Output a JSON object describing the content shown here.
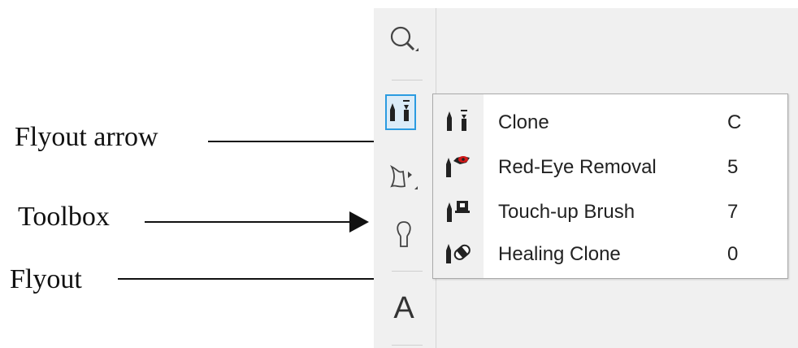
{
  "annotations": {
    "flyout_arrow": "Flyout arrow",
    "toolbox": "Toolbox",
    "flyout": "Flyout"
  },
  "toolbox": {
    "tools": [
      {
        "icon": "zoom-icon"
      },
      {
        "icon": "clone-tool-icon",
        "selected": true
      },
      {
        "icon": "smear-tool-icon"
      },
      {
        "icon": "paint-tool-icon"
      },
      {
        "icon": "text-tool-icon",
        "glyph": "A"
      }
    ]
  },
  "flyout_menu": {
    "items": [
      {
        "label": "Clone",
        "shortcut": "C",
        "icon": "clone-icon"
      },
      {
        "label": "Red-Eye Removal",
        "shortcut": "5",
        "icon": "red-eye-removal-icon"
      },
      {
        "label": "Touch-up Brush",
        "shortcut": "7",
        "icon": "touch-up-brush-icon"
      },
      {
        "label": "Healing Clone",
        "shortcut": "0",
        "icon": "healing-clone-icon"
      }
    ]
  },
  "colors": {
    "selection_border": "#2b9be0",
    "selection_fill": "#dcecf8",
    "red_eye": "#d01818"
  }
}
